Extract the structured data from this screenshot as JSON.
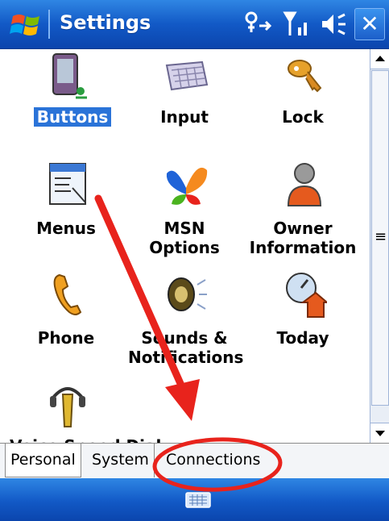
{
  "titlebar": {
    "title": "Settings",
    "status_icons": [
      "connectivity-icon",
      "signal-icon",
      "volume-icon"
    ],
    "close_label": "✕"
  },
  "items": [
    {
      "label": "Buttons",
      "icon": "buttons-icon",
      "selected": true
    },
    {
      "label": "Input",
      "icon": "keyboard-icon"
    },
    {
      "label": "Lock",
      "icon": "lock-keys-icon"
    },
    {
      "label": "Menus",
      "icon": "menus-icon"
    },
    {
      "label": "MSN Options",
      "icon": "msn-butterfly-icon"
    },
    {
      "label": "Owner",
      "label2": "Information",
      "icon": "owner-icon"
    },
    {
      "label": "Phone",
      "icon": "phone-icon"
    },
    {
      "label": "Sounds &",
      "label2": "Notifications",
      "icon": "speaker-icon"
    },
    {
      "label": "Today",
      "icon": "today-icon"
    },
    {
      "label": "Voice Speed Dial",
      "icon": "voice-icon"
    }
  ],
  "tabs": [
    {
      "label": "Personal",
      "active": true
    },
    {
      "label": "System"
    },
    {
      "label": "Connections"
    }
  ],
  "softbar": {
    "input_icon": "keyboard-input-icon"
  },
  "colors": {
    "title_bar": "#1259c6",
    "selection": "#2a73d8",
    "annotation_red": "#e8231c"
  }
}
